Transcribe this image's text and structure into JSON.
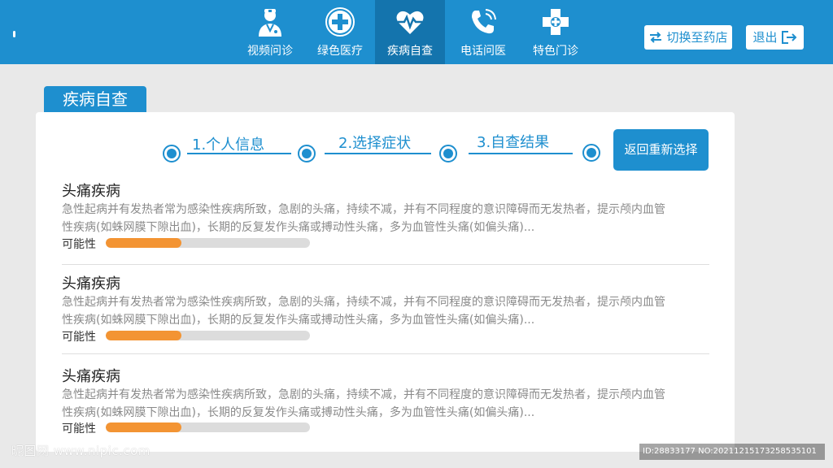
{
  "nav": {
    "items": [
      {
        "label": "视频问诊",
        "icon": "doctor-icon",
        "active": false
      },
      {
        "label": "绿色医疗",
        "icon": "medical-cross-icon",
        "active": false
      },
      {
        "label": "疾病自查",
        "icon": "heartbeat-icon",
        "active": true
      },
      {
        "label": "电话问医",
        "icon": "phone-icon",
        "active": false
      },
      {
        "label": "特色门诊",
        "icon": "clinic-cross-icon",
        "active": false
      }
    ],
    "switch_store": "切换至药店",
    "logout": "退出"
  },
  "page": {
    "tab_title": "疾病自查",
    "steps": [
      "1.个人信息",
      "2.选择症状",
      "3.自查结果"
    ],
    "reset_button": "返回重新选择"
  },
  "results": [
    {
      "title": "头痛疾病",
      "desc_line1": "急性起病并有发热者常为感染性疾病所致，急剧的头痛，持续不减，并有不同程度的意识障碍而无发热者，提示颅内血管",
      "desc_line2": "性疾病(如蛛网膜下隙出血)，长期的反复发作头痛或搏动性头痛，多为血管性头痛(如偏头痛)...",
      "prob_label": "可能性",
      "probability": 0.37
    },
    {
      "title": "头痛疾病",
      "desc_line1": "急性起病并有发热者常为感染性疾病所致，急剧的头痛，持续不减，并有不同程度的意识障碍而无发热者，提示颅内血管",
      "desc_line2": "性疾病(如蛛网膜下隙出血)，长期的反复发作头痛或搏动性头痛，多为血管性头痛(如偏头痛)...",
      "prob_label": "可能性",
      "probability": 0.37
    },
    {
      "title": "头痛疾病",
      "desc_line1": "急性起病并有发热者常为感染性疾病所致，急剧的头痛，持续不减，并有不同程度的意识障碍而无发热者，提示颅内血管",
      "desc_line2": "性疾病(如蛛网膜下隙出血)，长期的反复发作头痛或搏动性头痛，多为血管性头痛(如偏头痛)...",
      "prob_label": "可能性",
      "probability": 0.37
    }
  ],
  "watermark": {
    "left": "昵图网 www.nipic.com",
    "right": "ID:28833177 NO:20211215173258535101"
  },
  "colors": {
    "primary": "#1e8fcf",
    "active_nav": "#1474ad",
    "accent": "#f39433"
  }
}
